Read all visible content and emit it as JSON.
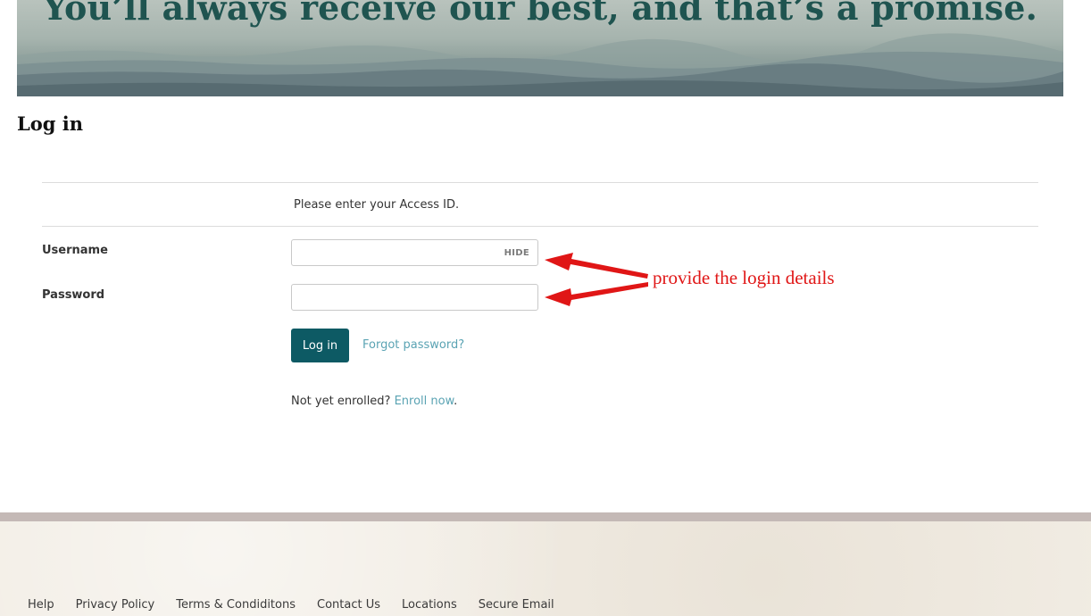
{
  "hero": {
    "tagline": "You’ll always receive our best, and that’s a promise."
  },
  "page": {
    "title": "Log in"
  },
  "form": {
    "instruction": "Please enter your Access ID.",
    "username_label": "Username",
    "password_label": "Password",
    "hide_toggle": "HIDE",
    "login_button": "Log in",
    "forgot_link": "Forgot password?",
    "enroll_prompt": "Not yet enrolled?",
    "enroll_link": "Enroll now",
    "enroll_suffix": "."
  },
  "annotation": {
    "text": "provide the login details",
    "color": "#e01616"
  },
  "footer": {
    "links": [
      "Help",
      "Privacy Policy",
      "Terms & Condiditons",
      "Contact Us",
      "Locations",
      "Secure Email"
    ]
  },
  "colors": {
    "primary_button": "#0d5a64",
    "link": "#5aa3b3",
    "tagline": "#1f5450"
  }
}
